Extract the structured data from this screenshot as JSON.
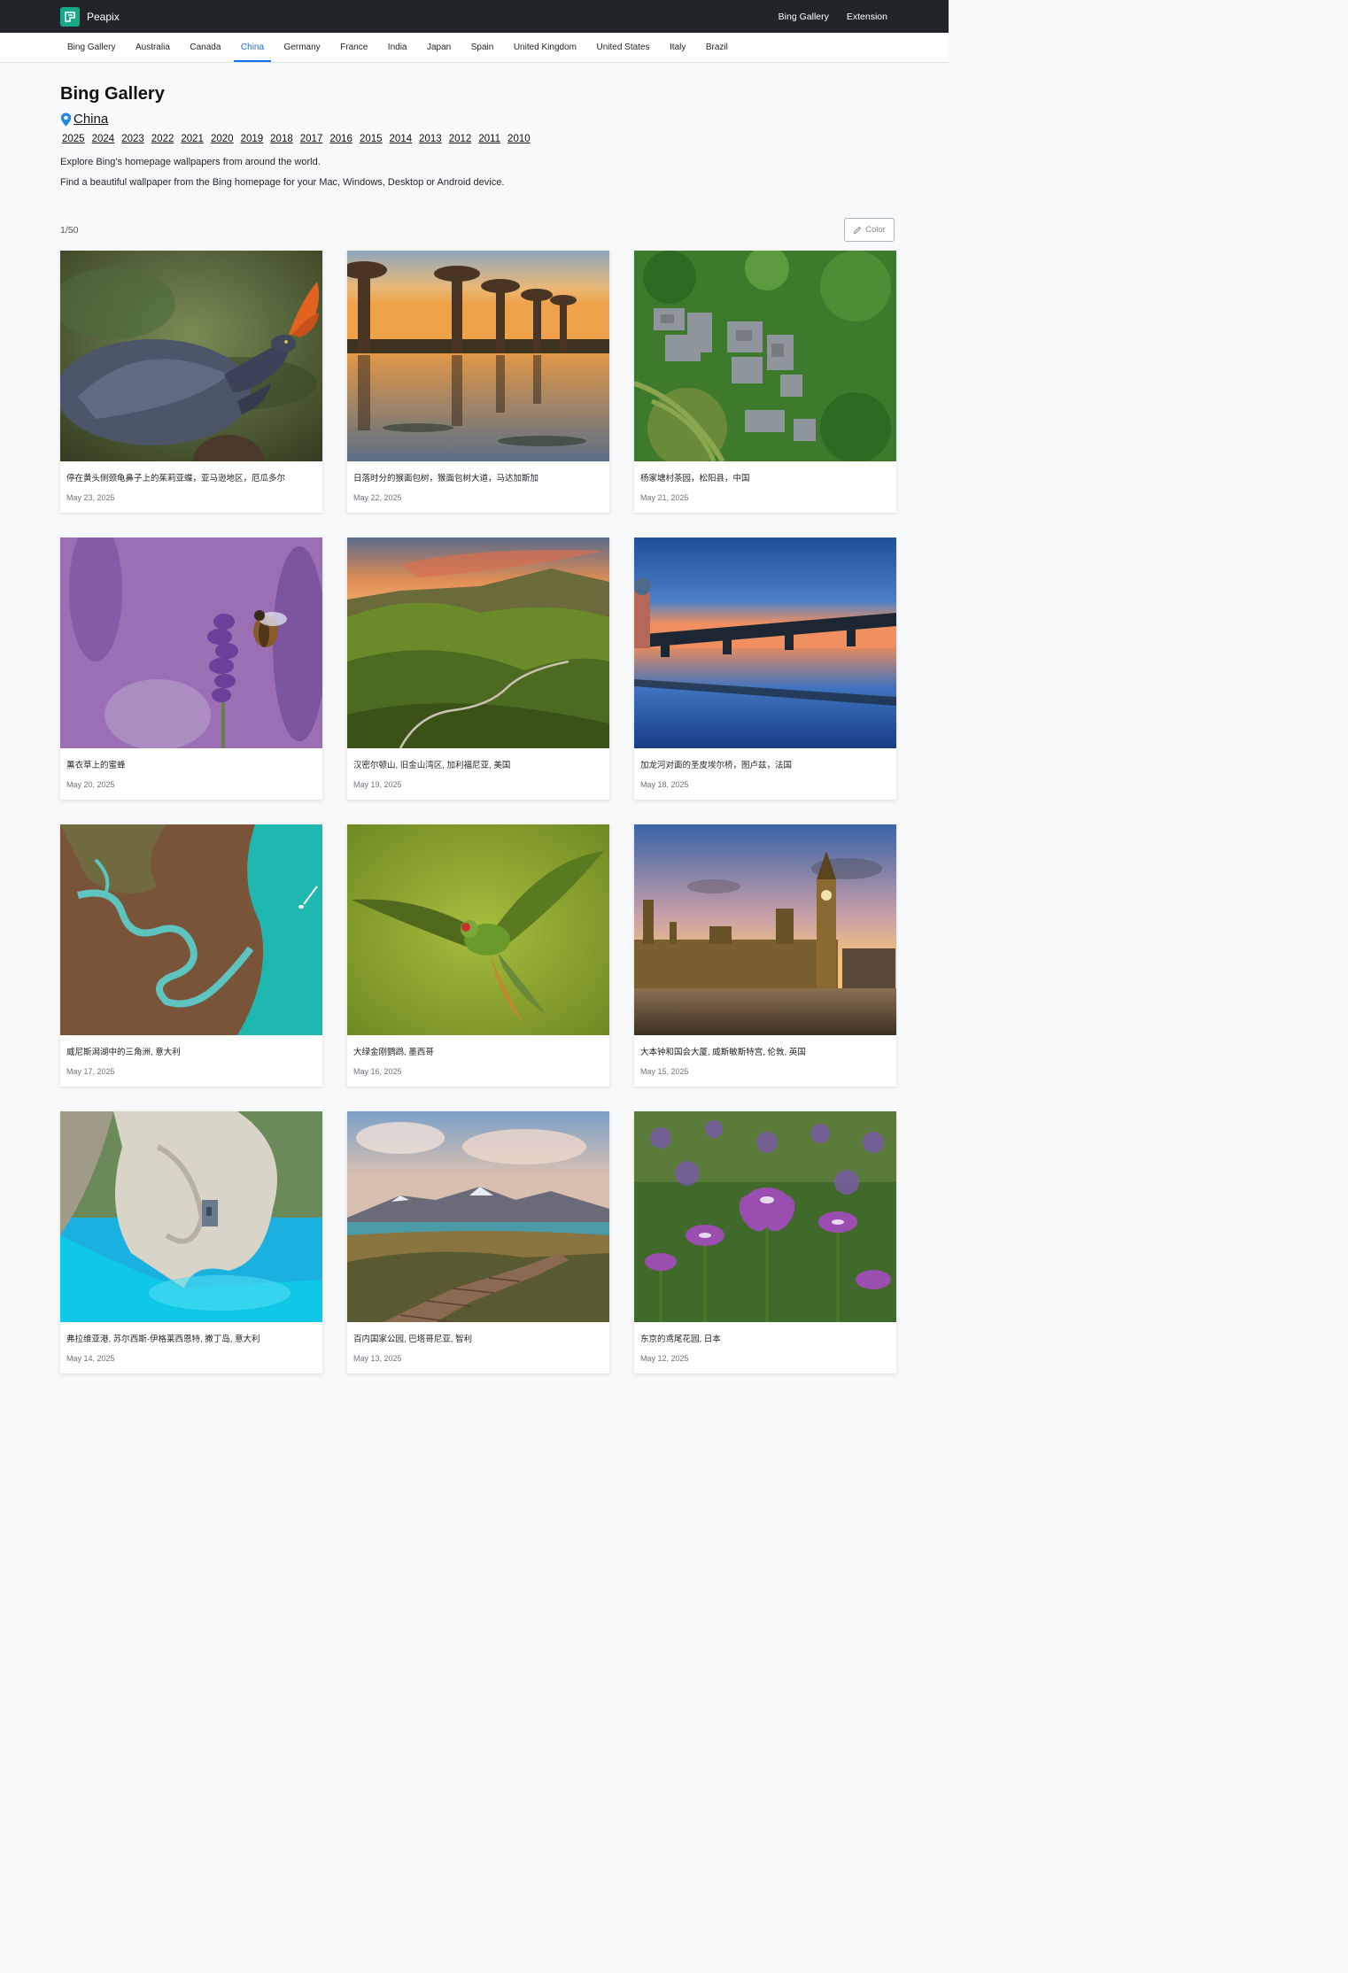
{
  "brand": {
    "name": "Peapix"
  },
  "topnav": {
    "gallery": "Bing Gallery",
    "extension": "Extension"
  },
  "tabs": [
    {
      "label": "Bing Gallery",
      "active": false
    },
    {
      "label": "Australia",
      "active": false
    },
    {
      "label": "Canada",
      "active": false
    },
    {
      "label": "China",
      "active": true
    },
    {
      "label": "Germany",
      "active": false
    },
    {
      "label": "France",
      "active": false
    },
    {
      "label": "India",
      "active": false
    },
    {
      "label": "Japan",
      "active": false
    },
    {
      "label": "Spain",
      "active": false
    },
    {
      "label": "United Kingdom",
      "active": false
    },
    {
      "label": "United States",
      "active": false
    },
    {
      "label": "Italy",
      "active": false
    },
    {
      "label": "Brazil",
      "active": false
    }
  ],
  "header": {
    "title": "Bing Gallery",
    "region": "China",
    "years": [
      "2025",
      "2024",
      "2023",
      "2022",
      "2021",
      "2020",
      "2019",
      "2018",
      "2017",
      "2016",
      "2015",
      "2014",
      "2013",
      "2012",
      "2011",
      "2010"
    ],
    "desc1": "Explore Bing's homepage wallpapers from around the world.",
    "desc2": "Find a beautiful wallpaper from the Bing homepage for your Mac, Windows, Desktop or Android device."
  },
  "toolbar": {
    "counter": "1/50",
    "color_label": "Color"
  },
  "colors": {
    "accent": "#0d6efd",
    "topbar": "#212529",
    "brand": "#1aa88a"
  },
  "cards": [
    {
      "title": "停在黄头侧颈龟鼻子上的茱莉亚蝶，亚马逊地区，厄瓜多尔",
      "date": "May 23, 2025",
      "scene": "turtle-butterfly"
    },
    {
      "title": "日落时分的猴面包树，猴面包树大道，马达加斯加",
      "date": "May 22, 2025",
      "scene": "baobabs-sunset"
    },
    {
      "title": "杨家塘村茶园，松阳县，中国",
      "date": "May 21, 2025",
      "scene": "tea-village-aerial"
    },
    {
      "title": "薰衣草上的蜜蜂",
      "date": "May 20, 2025",
      "scene": "bee-lavender"
    },
    {
      "title": "汉密尔顿山, 旧金山湾区, 加利福尼亚, 美国",
      "date": "May 19, 2025",
      "scene": "green-hills"
    },
    {
      "title": "加龙河对面的圣皮埃尔桥，图卢兹，法国",
      "date": "May 18, 2025",
      "scene": "bridge-reflection"
    },
    {
      "title": "威尼斯潟湖中的三角洲, 意大利",
      "date": "May 17, 2025",
      "scene": "lagoon-delta"
    },
    {
      "title": "大绿金刚鹦鹉, 墨西哥",
      "date": "May 16, 2025",
      "scene": "green-macaw"
    },
    {
      "title": "大本钟和国会大厦, 威斯敏斯特宫, 伦敦, 英国",
      "date": "May 15, 2025",
      "scene": "big-ben"
    },
    {
      "title": "弗拉维亚港, 苏尔西斯-伊格莱西恩特, 撒丁岛, 意大利",
      "date": "May 14, 2025",
      "scene": "sea-cliff"
    },
    {
      "title": "百内国家公园, 巴塔哥尼亚, 智利",
      "date": "May 13, 2025",
      "scene": "patagonia-boardwalk"
    },
    {
      "title": "东京的鸢尾花园, 日本",
      "date": "May 12, 2025",
      "scene": "iris-garden"
    }
  ]
}
